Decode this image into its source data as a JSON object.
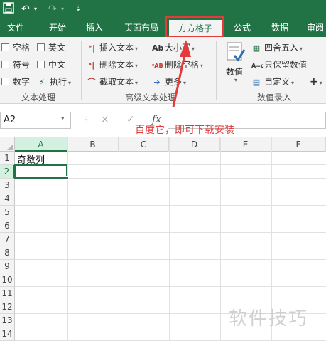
{
  "titlebar": {
    "app_icon": "excel-save-icon",
    "undo_icon": "undo-icon",
    "redo_icon": "redo-icon"
  },
  "tabs": [
    {
      "label": "文件"
    },
    {
      "label": "开始"
    },
    {
      "label": "插入"
    },
    {
      "label": "页面布局"
    },
    {
      "label": "方方格子",
      "active": true
    },
    {
      "label": "公式"
    },
    {
      "label": "数据"
    },
    {
      "label": "审阅"
    }
  ],
  "ribbon": {
    "text_group": {
      "label": "文本处理",
      "items": [
        "空格",
        "英文",
        "符号",
        "中文",
        "数字",
        "执行"
      ]
    },
    "advanced_group": {
      "label": "高级文本处理",
      "items": [
        "插入文本",
        "删除文本",
        "截取文本",
        "大小写",
        "删除空格",
        "更多"
      ]
    },
    "value_group": {
      "label": "数值录入",
      "big_button": "数值",
      "items": [
        "四舍五入",
        "只保留数值",
        "自定义"
      ]
    }
  },
  "formula_bar": {
    "name_box": "A2",
    "cancel": "×",
    "confirm": "✓",
    "fx": "fx",
    "value": ""
  },
  "grid": {
    "columns": [
      "A",
      "B",
      "C",
      "D",
      "E",
      "F"
    ],
    "rows": [
      "1",
      "2",
      "3",
      "4",
      "5",
      "6",
      "7",
      "8",
      "9",
      "10",
      "11",
      "12",
      "13",
      "14"
    ],
    "cells": {
      "A1": "奇数列"
    }
  },
  "annotation": "百度它，即可下载安装",
  "watermark": "软件技巧",
  "colors": {
    "excel_green": "#217346",
    "annotation_red": "#e5393a"
  }
}
